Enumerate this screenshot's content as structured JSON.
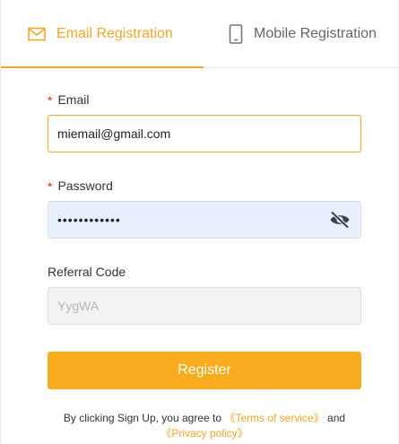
{
  "tabs": {
    "email_label": "Email Registration",
    "mobile_label": "Mobile Registration",
    "active": "email"
  },
  "form": {
    "email_label": "Email",
    "email_value": "miemail@gmail.com",
    "password_label": "Password",
    "password_value": "••••••••••••",
    "referral_label": "Referral Code",
    "referral_value": "YygWA",
    "required_mark": "*",
    "register_label": "Register"
  },
  "terms": {
    "prefix": "By clicking Sign Up, you agree to",
    "terms_link": "《Terms of service》",
    "conjunction": "and",
    "privacy_link": "《Privacy policy》"
  },
  "colors": {
    "accent": "#f5a623",
    "button": "#f9ac1d",
    "required": "#e2231a",
    "autofill_bg": "#e8f0fe"
  },
  "icons": {
    "email_tab": "envelope-icon",
    "mobile_tab": "mobile-phone-icon",
    "password_toggle": "eye-slash-icon"
  }
}
